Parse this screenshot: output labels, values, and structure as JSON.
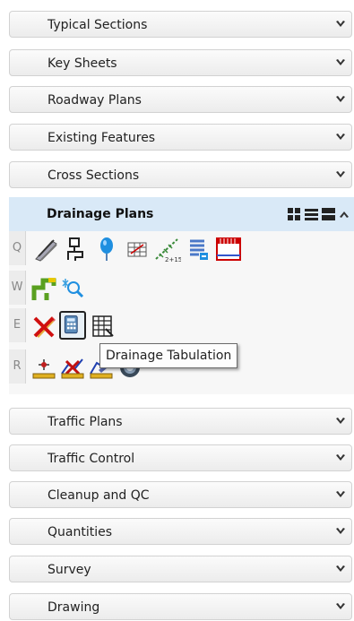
{
  "sections_before": [
    {
      "label": "Typical Sections",
      "chevron": "chevron-down-icon"
    },
    {
      "label": "Key Sheets",
      "chevron": "chevron-down-icon"
    },
    {
      "label": "Roadway Plans",
      "chevron": "chevron-down-icon"
    },
    {
      "label": "Existing Features",
      "chevron": "chevron-down-icon"
    },
    {
      "label": "Cross Sections",
      "chevron": "chevron-down-icon"
    }
  ],
  "expanded_section": {
    "label": "Drainage Plans",
    "header_icons": [
      "grid-view-icon",
      "list-view-icon",
      "large-view-icon",
      "chevron-up-icon"
    ],
    "rows": [
      {
        "key": "Q",
        "tools": [
          "pipe-tool-icon",
          "structure-tool-icon",
          "balloon-tool-icon",
          "grid-tool-icon",
          "profile-station-tool-icon",
          "notes-tool-icon",
          "calendar-table-tool-icon"
        ]
      },
      {
        "key": "W",
        "tools": [
          "connector-tool-icon",
          "find-tool-icon"
        ]
      },
      {
        "key": "E",
        "tools": [
          "delete-tool-icon",
          "drainage-tabulation-tool-icon",
          "table-tool-icon"
        ]
      },
      {
        "key": "R",
        "tools": [
          "survey-tool-icon",
          "section-tool-icon",
          "section-edit-tool-icon",
          "drum-tool-icon"
        ]
      }
    ],
    "tooltip": "Drainage Tabulation"
  },
  "sections_after": [
    {
      "label": "Traffic Plans",
      "chevron": "chevron-down-icon"
    },
    {
      "label": "Traffic Control",
      "chevron": "chevron-down-icon"
    },
    {
      "label": "Cleanup and QC",
      "chevron": "chevron-down-icon"
    },
    {
      "label": "Quantities",
      "chevron": "chevron-down-icon"
    },
    {
      "label": "Survey",
      "chevron": "chevron-down-icon"
    },
    {
      "label": "Drawing",
      "chevron": "chevron-down-icon"
    }
  ],
  "colors": {
    "header_highlight": "#d9e9f7",
    "section_border": "#d2d2d2"
  }
}
